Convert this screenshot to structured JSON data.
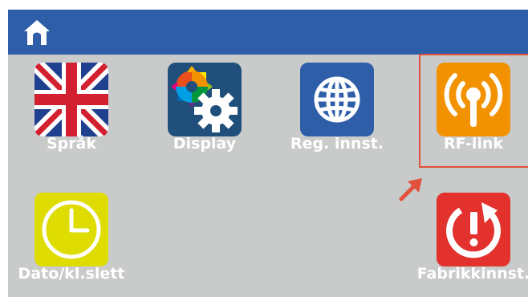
{
  "header": {
    "home_icon": "home-icon",
    "color": "#2f5ea9"
  },
  "tiles": [
    {
      "label": "Språk",
      "icon": "uk-flag-icon"
    },
    {
      "label": "Display",
      "icon": "color-gear-icon"
    },
    {
      "label": "Reg. innst.",
      "icon": "globe-icon"
    },
    {
      "label": "RF-link",
      "icon": "antenna-icon",
      "selected": true
    },
    {
      "label": "Dato/kl.slett",
      "icon": "clock-icon"
    },
    {
      "label": "Fabrikkinnst.",
      "icon": "factory-reset-icon"
    }
  ],
  "colors": {
    "background": "#c9caca",
    "highlight": "#e2513c",
    "orange": "#f39200",
    "yellow": "#dedc00",
    "red": "#e3312d",
    "blue": "#2f5ea9",
    "navy": "#1f4f7a"
  }
}
